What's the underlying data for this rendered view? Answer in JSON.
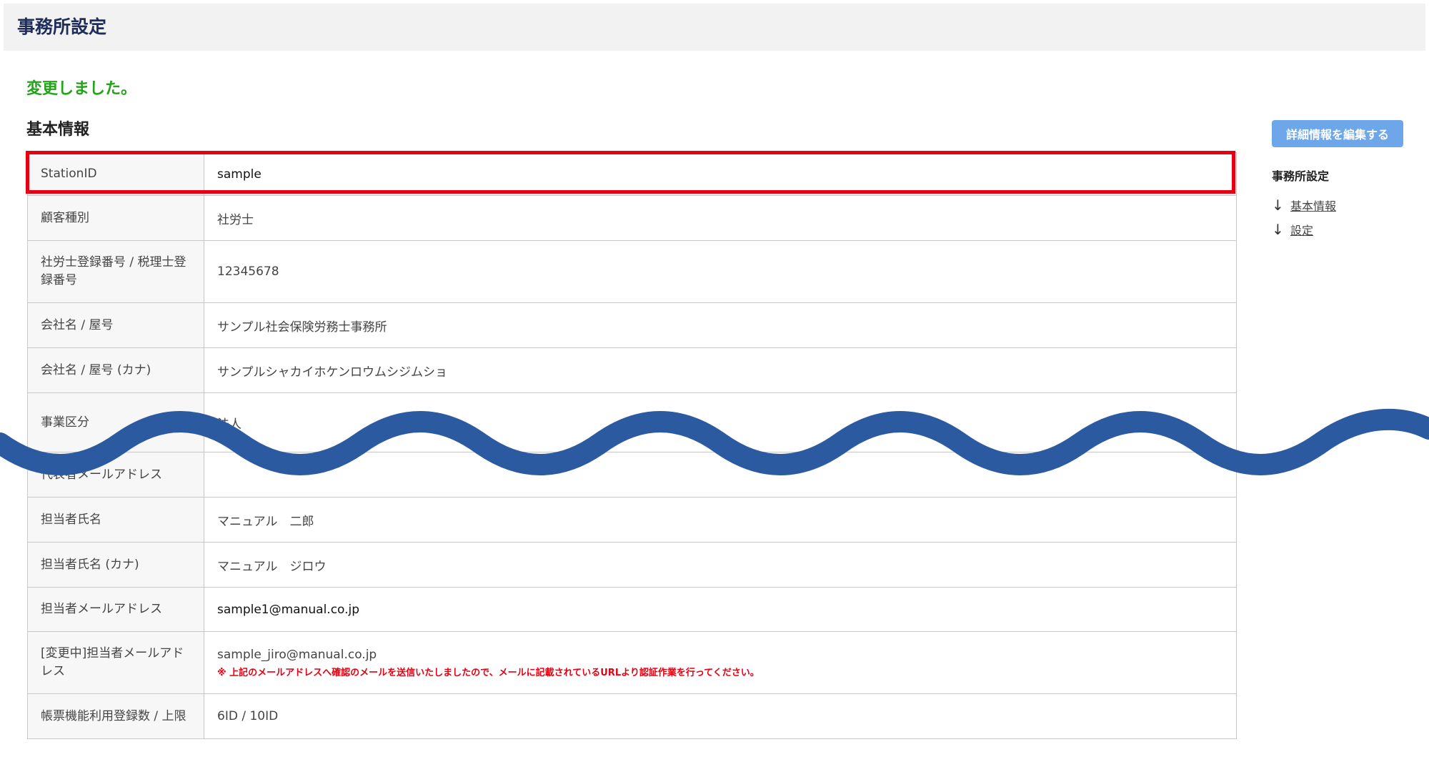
{
  "header": {
    "title": "事務所設定"
  },
  "flash": {
    "message": "変更しました。"
  },
  "section": {
    "title": "基本情報"
  },
  "rows": [
    {
      "label": "StationID",
      "value": "sample"
    },
    {
      "label": "顧客種別",
      "value": "社労士"
    },
    {
      "label": "社労士登録番号 / 税理士登録番号",
      "value": "12345678"
    },
    {
      "label": "会社名 / 屋号",
      "value": "サンプル社会保険労務士事務所"
    },
    {
      "label": "会社名 / 屋号 (カナ)",
      "value": "サンプルシャカイホケンロウムシジムショ"
    },
    {
      "label": "事業区分",
      "value": "法人"
    },
    {
      "label": "代表者メールアドレス",
      "value": ""
    },
    {
      "label": "担当者氏名",
      "value": "マニュアル　二郎"
    },
    {
      "label": "担当者氏名 (カナ)",
      "value": "マニュアル　ジロウ"
    },
    {
      "label": "担当者メールアドレス",
      "value": "sample1@manual.co.jp"
    },
    {
      "label": "[変更中]担当者メールアドレス",
      "value": "sample_jiro@manual.co.jp",
      "note": "※ 上記のメールアドレスへ確認のメールを送信いたしましたので、メールに記載されているURLより認証作業を行ってください。"
    },
    {
      "label": "帳票機能利用登録数 / 上限",
      "value": "6ID / 10ID"
    }
  ],
  "sidebar": {
    "edit_button": "詳細情報を編集する",
    "nav_title": "事務所設定",
    "links": [
      "基本情報",
      "設定"
    ],
    "arrow_icon": "arrow-down-icon"
  },
  "colors": {
    "success": "#22a319",
    "highlight": "#e60012",
    "button": "#6ea6ea",
    "wave": "#2c5aa0",
    "title": "#1f2d5a"
  }
}
